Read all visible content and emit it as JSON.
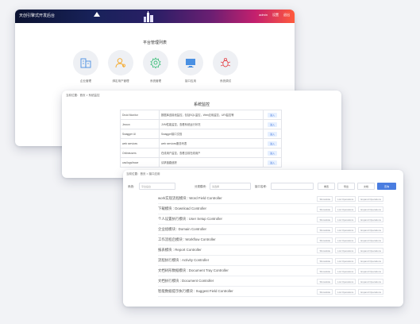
{
  "card1": {
    "app_title": "天创引擎式开发后台",
    "user": {
      "name": "admin",
      "settings": "设置",
      "logout": "退出"
    },
    "platform_title": "平台管理列表",
    "modules": [
      {
        "label": "企业管理",
        "icon": "building-icon"
      },
      {
        "label": "绑定用户管理",
        "icon": "user-settings-icon"
      },
      {
        "label": "系统管理",
        "icon": "gear-icon"
      },
      {
        "label": "接口应用",
        "icon": "monitor-icon"
      },
      {
        "label": "系统调试",
        "icon": "bug-icon"
      }
    ]
  },
  "card2": {
    "breadcrumb": "当前位置：首页 > 系统监控",
    "title": "系统监控",
    "action_label": "进入",
    "rows": [
      {
        "name": "Druid Monitor",
        "desc": "数据库连接池监控，包括SQL监控，Web应用监控，URI监控等"
      },
      {
        "name": "Jmxon",
        "desc": "JVM性能监控，查看系统运行状况"
      },
      {
        "name": "Swagger UI",
        "desc": "Swagger接口文档"
      },
      {
        "name": "web services",
        "desc": "web services服务列表"
      },
      {
        "name": "Onlineusers",
        "desc": "在线用户监控，查看当前在线用户"
      },
      {
        "name": "cas/logs/trace",
        "desc": "请求链路追踪"
      }
    ]
  },
  "card3": {
    "breadcrumb": "当前位置：首页 > 接口应用",
    "filters": {
      "f1_label": "系统:",
      "f1_value": "平台后台",
      "f2_label": "分类模块:",
      "f2_value": "请选择",
      "f3_label": "接口名称:",
      "f3_value": ""
    },
    "buttons": {
      "b1": "重置",
      "b2": "导出",
      "b3": "文档",
      "b4": "查询"
    },
    "ops": [
      "ShowHide",
      "List Operations",
      "Expand Operations"
    ],
    "rows": [
      "work实现流程模块 : Word Field Controller",
      "下载模块 : Download Controller",
      "个人设置执行模块 : User Setup Controller",
      "企业组模块 : Domain Controller",
      "工作流程启模块 : Workflow Controller",
      "报表模块 : Report Controller",
      "流程执行模块 : Activity Controller",
      "文档树形数据模块 : Document Tray Controller",
      "文档执行模块 : Document Controller",
      "智能数据提示执行模块 : Suggest Field Controller"
    ]
  }
}
